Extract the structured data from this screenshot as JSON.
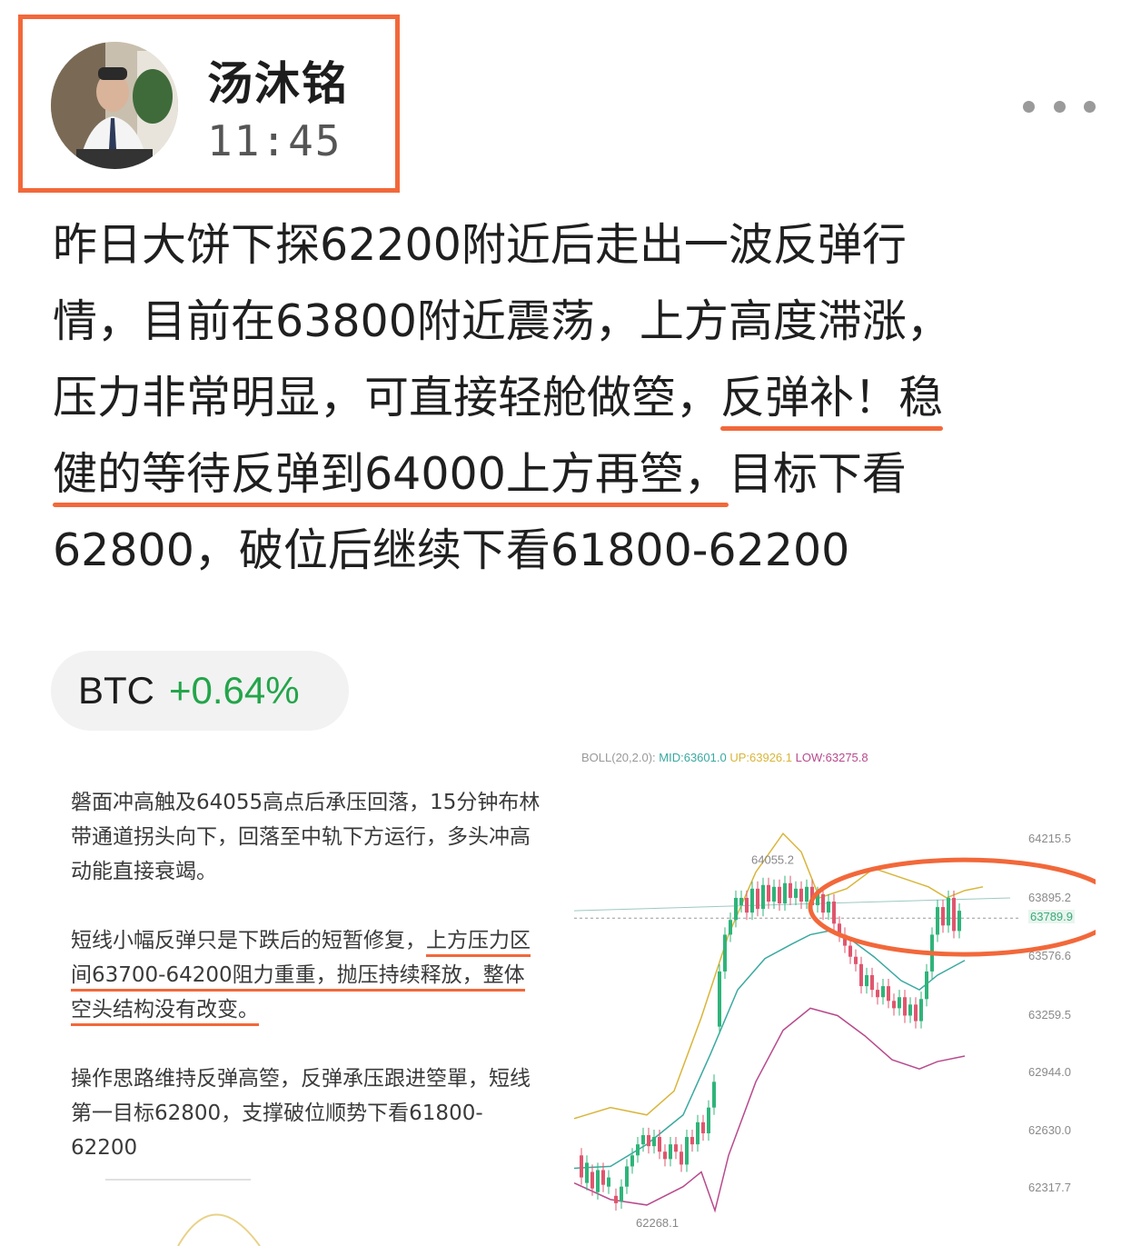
{
  "header": {
    "author_name": "汤沐铭",
    "post_time": "11:45"
  },
  "post": {
    "line1": "昨日大饼下探62200附近后走出一波反弹行",
    "line2": "情，目前在63800附近震荡，上方高度滞涨，",
    "line3_a": "压力非常明显，可直接轻舱做箜，",
    "line3_b": "反弹补！稳",
    "line4_a": "健的等待反弹到64000上方再箜，",
    "line4_b": "目标下看",
    "line5": "62800，破位后继续下看61800-62200"
  },
  "ticker": {
    "symbol": "BTC",
    "change": "+0.64%"
  },
  "image_text": {
    "para1": "磐面冲高触及64055高点后承压回落，15分钟布林带通道拐头向下，回落至中轨下方运行，多头冲高动能直接衰竭。",
    "para2_a": "短线小幅反弹只是下跌后的短暂修复，",
    "para2_b": "上方压力区间63700-64200阻力重重，抛压持续释放，整体空头结构没有改变。",
    "para3": "操作思路维持反弹高箜，反弹承压跟进箜單，短线第一目标62800，支撑破位顺势下看61800-62200"
  },
  "chart_data": {
    "type": "line",
    "indicator_label": "BOLL(20,2.0):",
    "mid_label": "MID:63601.0",
    "up_label": "UP:63926.1",
    "low_label": "LOW:63275.8",
    "y_ticks": [
      "64215.5",
      "63895.2",
      "63789.9",
      "63576.6",
      "63259.5",
      "62944.0",
      "62630.0",
      "62317.7"
    ],
    "high_marker": "64055.2",
    "low_marker": "62268.1",
    "ylim": [
      62200,
      64300
    ],
    "colors": {
      "up": "#2fb47a",
      "down": "#e0566e",
      "mid": "#3aa9a0",
      "upper": "#d9b53a",
      "lower": "#b84a8c",
      "highlight": "#f2683a"
    }
  }
}
